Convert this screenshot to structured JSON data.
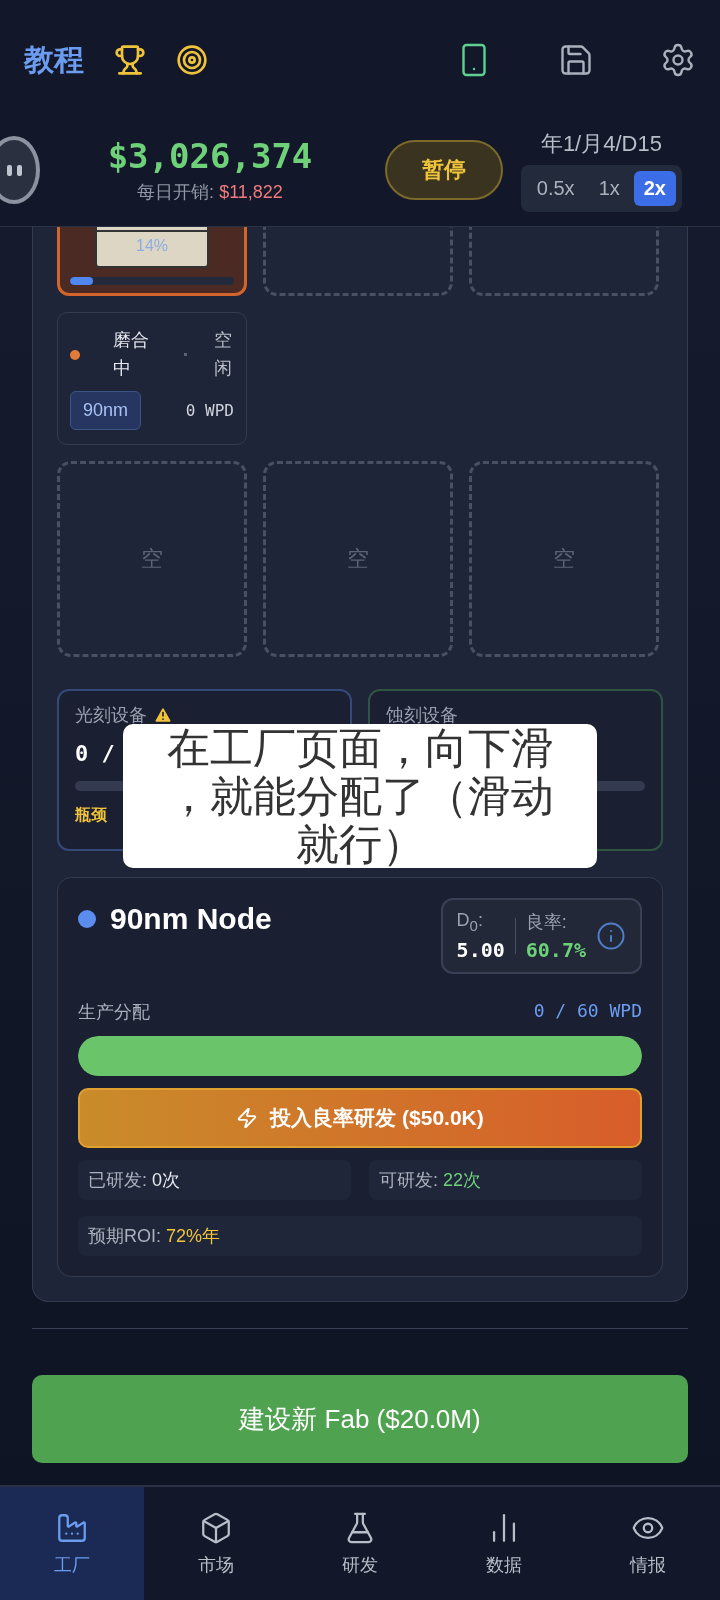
{
  "header": {
    "title": "教程",
    "balance": "$3,026,374",
    "daily_cost_label": "每日开销:",
    "daily_cost": "$11,822",
    "pause_button": "暂停",
    "date": "年1/月4/D15",
    "speeds": [
      {
        "label": "0.5x",
        "selected": false
      },
      {
        "label": "1x",
        "selected": false
      },
      {
        "label": "2x",
        "selected": true
      }
    ]
  },
  "machine": {
    "progress_text": "14%",
    "level": 0.14
  },
  "status_card": {
    "state": "磨合中",
    "color": "#e07b39",
    "status": "空闲",
    "node": "90nm",
    "output": "0 WPD"
  },
  "slots": [
    {
      "label": "空"
    },
    {
      "label": "空"
    },
    {
      "label": "空"
    }
  ],
  "equipment": [
    {
      "name": "光刻设备",
      "warning": true,
      "count": "0 /",
      "note": "瓶颈",
      "color": "#34497a"
    },
    {
      "name": "蚀刻设备",
      "warning": false,
      "color": "#2f5540"
    }
  ],
  "node_card": {
    "name": "90nm Node",
    "color": "#5b8def",
    "d0_label": "D$_{0}$:",
    "d0": "5.00",
    "yield_label": "良率:",
    "yield": "60.7%",
    "allocation_label": "生产分配",
    "allocation": "0 / 60 WPD",
    "allocation_slider": {
      "level": 1
    },
    "research_button": "投入良率研发 ($50.0K)",
    "stats": [
      {
        "label": "已研发:",
        "value": "0次",
        "kind": "plain"
      },
      {
        "label": "可研发:",
        "value": "22次",
        "kind": "good"
      }
    ],
    "roi": {
      "label": "预期ROI:",
      "value": "72%年"
    }
  },
  "build_button": "建设新 Fab ($20.0M)",
  "caption": "在工厂页面，向下滑，就能分配了（滑动就行）",
  "nav": [
    {
      "label": "工厂",
      "selected": true
    },
    {
      "label": "市场",
      "selected": false
    },
    {
      "label": "研发",
      "selected": false
    },
    {
      "label": "数据",
      "selected": false
    },
    {
      "label": "情报",
      "selected": false
    }
  ]
}
